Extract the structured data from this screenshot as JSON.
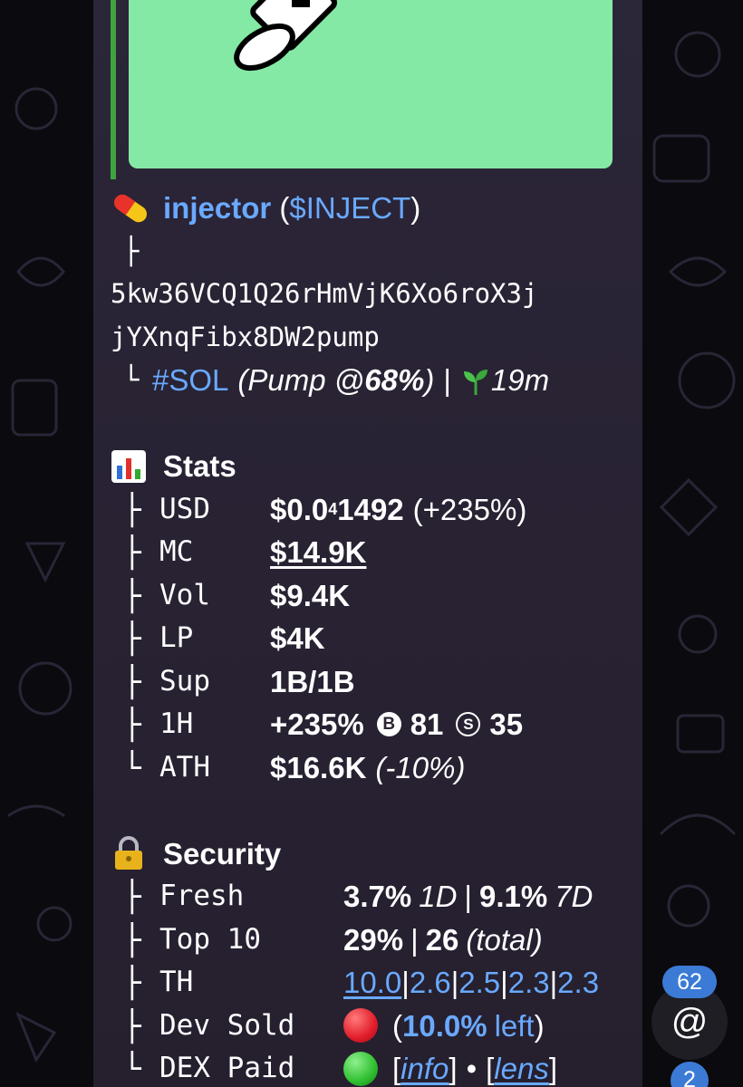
{
  "token": {
    "emoji_icon": "pill-icon",
    "name": "injector",
    "ticker": "$INJECT",
    "tree_branch": "├",
    "address_line1": "5kw36VCQ1Q26rHmVjK6Xo6roX3j",
    "address_line2": "jYXnqFibx8DW2pump",
    "tree_end": "└",
    "chain": "#SOL",
    "platform_prefix": "(Pump @ ",
    "platform_pct": "68%",
    "platform_suffix": ")",
    "separator": "|",
    "age_icon": "seedling-icon",
    "age": "19m"
  },
  "stats": {
    "icon": "bar-chart-icon",
    "title": "Stats",
    "rows": [
      {
        "tree": "├",
        "key": "USD",
        "value_main": "$0.0",
        "value_sub": "4",
        "value_rest": "1492",
        "value_extra": "(+235%)"
      },
      {
        "tree": "├",
        "key": "MC",
        "value": "$14.9K"
      },
      {
        "tree": "├",
        "key": "Vol",
        "value": "$9.4K"
      },
      {
        "tree": "├",
        "key": "LP",
        "value": "$4K"
      },
      {
        "tree": "├",
        "key": "Sup",
        "value": "1B/1B"
      },
      {
        "tree": "├",
        "key": "1H",
        "value": "+235%",
        "buy_letter": "B",
        "buys": "81",
        "sell_letter": "S",
        "sells": "35"
      },
      {
        "tree": "└",
        "key": "ATH",
        "value": "$16.6K",
        "value_extra": "(-10%)"
      }
    ]
  },
  "security": {
    "icon": "lock-icon",
    "title": "Security",
    "rows": [
      {
        "tree": "├",
        "key": "Fresh",
        "v1": "3.7%",
        "v1_label": "1D",
        "sep": "|",
        "v2": "9.1%",
        "v2_label": "7D"
      },
      {
        "tree": "├",
        "key": "Top 10",
        "v1": "29%",
        "sep": "|",
        "v2": "26",
        "v2_label": "(total)"
      },
      {
        "tree": "├",
        "key": "TH",
        "holders": [
          "10.0",
          "2.6",
          "2.5",
          "2.3",
          "2.3"
        ],
        "sep": "|"
      },
      {
        "tree": "├",
        "key": "Dev Sold",
        "status_color": "#e11d2a",
        "open": "(",
        "value": "10.0%",
        "left": "left",
        "close": ")"
      },
      {
        "tree": "└",
        "key": "DEX Paid",
        "status_color": "#2fbf2f",
        "info_open": "[",
        "info": "info",
        "info_close": "]",
        "dot": "•",
        "lens_open": "[",
        "lens": "lens",
        "lens_close": "]"
      }
    ]
  },
  "ui": {
    "unread_badge": "62",
    "mention_icon": "@",
    "badge2": "2"
  },
  "colors": {
    "link": "#6aa9ff",
    "bubble": "#2a2433",
    "media_bg": "#85e9a6",
    "accent_bar": "#3fa33f"
  }
}
